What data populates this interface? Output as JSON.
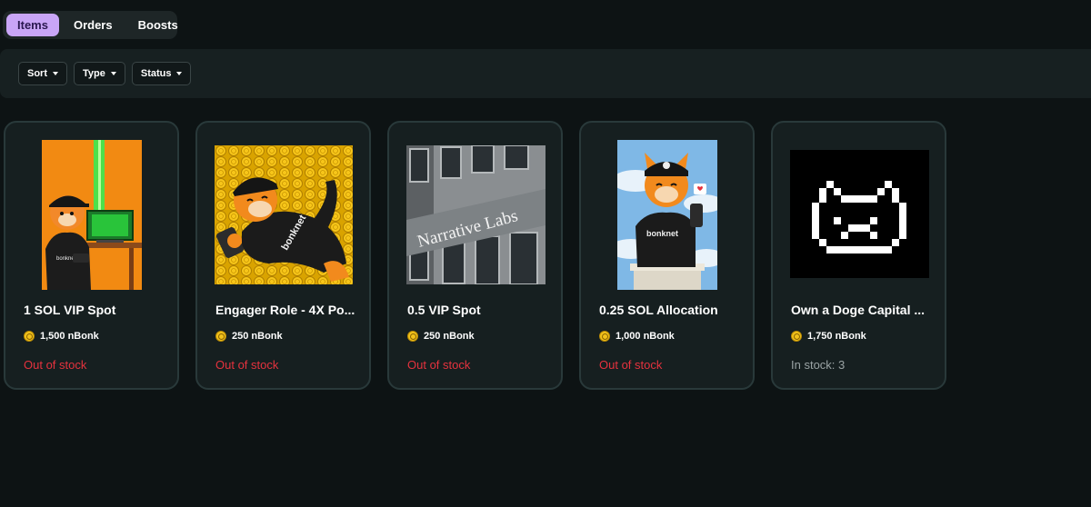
{
  "tabs": [
    {
      "label": "Items",
      "active": true
    },
    {
      "label": "Orders",
      "active": false
    },
    {
      "label": "Boosts",
      "active": false
    }
  ],
  "filters": [
    {
      "label": "Sort",
      "icon": "chevron-down-icon"
    },
    {
      "label": "Type",
      "icon": "chevron-down-icon"
    },
    {
      "label": "Status",
      "icon": "chevron-down-icon"
    }
  ],
  "items": [
    {
      "title": "1 SOL VIP Spot",
      "price": "1,500 nBonk",
      "stock": "Out of stock",
      "in_stock": false,
      "image": "bonk-dog-at-computer-image",
      "image_text": "bonknet"
    },
    {
      "title": "Engager Role - 4X Po...",
      "price": "250 nBonk",
      "stock": "Out of stock",
      "in_stock": false,
      "image": "bonk-dog-lying-on-coins-image",
      "image_text": "bonknet"
    },
    {
      "title": "0.5 VIP Spot",
      "price": "250 nBonk",
      "stock": "Out of stock",
      "in_stock": false,
      "image": "narrative-labs-building-image",
      "image_text": "Narrative Labs"
    },
    {
      "title": "0.25 SOL Allocation",
      "price": "1,000 nBonk",
      "stock": "Out of stock",
      "in_stock": false,
      "image": "bonk-dog-statue-phone-image",
      "image_text": "bonknet"
    },
    {
      "title": "Own a Doge Capital ...",
      "price": "1,750 nBonk",
      "stock": "In stock: 3",
      "in_stock": true,
      "image": "pixel-doge-logo-image"
    }
  ],
  "colors": {
    "background": "#0d1314",
    "card": "#161f20",
    "tab_active": "#c9a5f7",
    "out_of_stock": "#e5323e",
    "in_stock": "#9aa3a4",
    "coin": "#f2c21b"
  }
}
